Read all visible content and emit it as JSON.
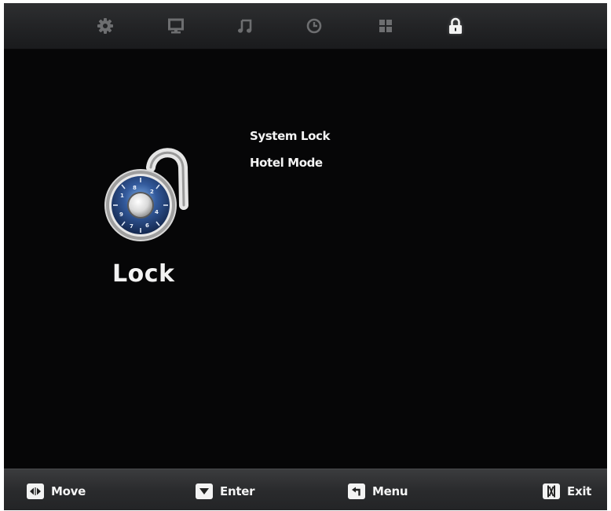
{
  "top_tabs": [
    {
      "icon": "gear-icon",
      "active": false
    },
    {
      "icon": "monitor-icon",
      "active": false
    },
    {
      "icon": "music-note-icon",
      "active": false
    },
    {
      "icon": "clock-icon",
      "active": false
    },
    {
      "icon": "grid-icon",
      "active": false
    },
    {
      "icon": "lock-icon",
      "active": true
    }
  ],
  "section": {
    "title": "Lock",
    "icon": "combination-padlock-icon"
  },
  "menu": {
    "items": [
      {
        "label": "System Lock"
      },
      {
        "label": "Hotel Mode"
      }
    ]
  },
  "footer": {
    "move_label": "Move",
    "enter_label": "Enter",
    "menu_label": "Menu",
    "exit_label": "Exit"
  },
  "colors": {
    "background": "#070708",
    "topbar": "#222325",
    "footer": "#2a2b2d",
    "text": "#f4f4f4",
    "inactive_icon": "#6d6e70",
    "active_icon": "#f2f2f2",
    "dial_blue": "#2f4e8c"
  }
}
